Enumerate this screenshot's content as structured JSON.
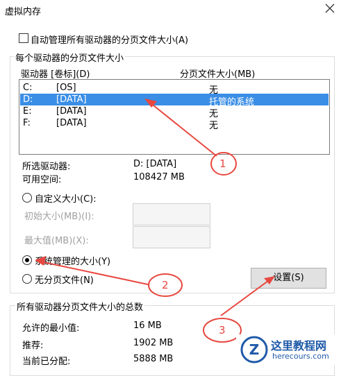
{
  "window": {
    "title": "虚拟内存"
  },
  "auto_manage": {
    "label": "自动管理所有驱动器的分页文件大小(A)",
    "checked": false
  },
  "per_drive": {
    "group_title": "每个驱动器的分页文件大小",
    "columns": {
      "drive": "驱动器 [卷标](D)",
      "size": "分页文件大小(MB)"
    },
    "rows": [
      {
        "drive": "C:",
        "label": "[OS]",
        "size": "无",
        "selected": false
      },
      {
        "drive": "D:",
        "label": "[DATA]",
        "size": "托管的系统",
        "selected": true
      },
      {
        "drive": "E:",
        "label": "[DATA]",
        "size": "无",
        "selected": false
      },
      {
        "drive": "F:",
        "label": "[DATA]",
        "size": "无",
        "selected": false
      }
    ],
    "selected_drive_label": "所选驱动器:",
    "selected_drive_value": "D:  [DATA]",
    "free_space_label": "可用空间:",
    "free_space_value": "108427 MB",
    "custom_size_label": "自定义大小(C):",
    "initial_label": "初始大小(MB)(I):",
    "max_label": "最大值(MB)(X):",
    "system_managed_label": "系统管理的大小(Y)",
    "no_paging_label": "无分页文件(N)",
    "set_button": "设置(S)"
  },
  "totals": {
    "group_title": "所有驱动器分页文件大小的总数",
    "min_label": "允许的最小值:",
    "min_value": "16 MB",
    "recommended_label": "推荐:",
    "recommended_value": "1902 MB",
    "current_label": "当前已分配:",
    "current_value": "5888 MB"
  },
  "annotations": {
    "one": "1",
    "two": "2",
    "three": "3"
  },
  "watermark": {
    "title": "这里教程网",
    "url": "herecours.com",
    "letter": "Z"
  },
  "colors": {
    "selection": "#3a8ee6",
    "annotation": "#e8473f"
  }
}
